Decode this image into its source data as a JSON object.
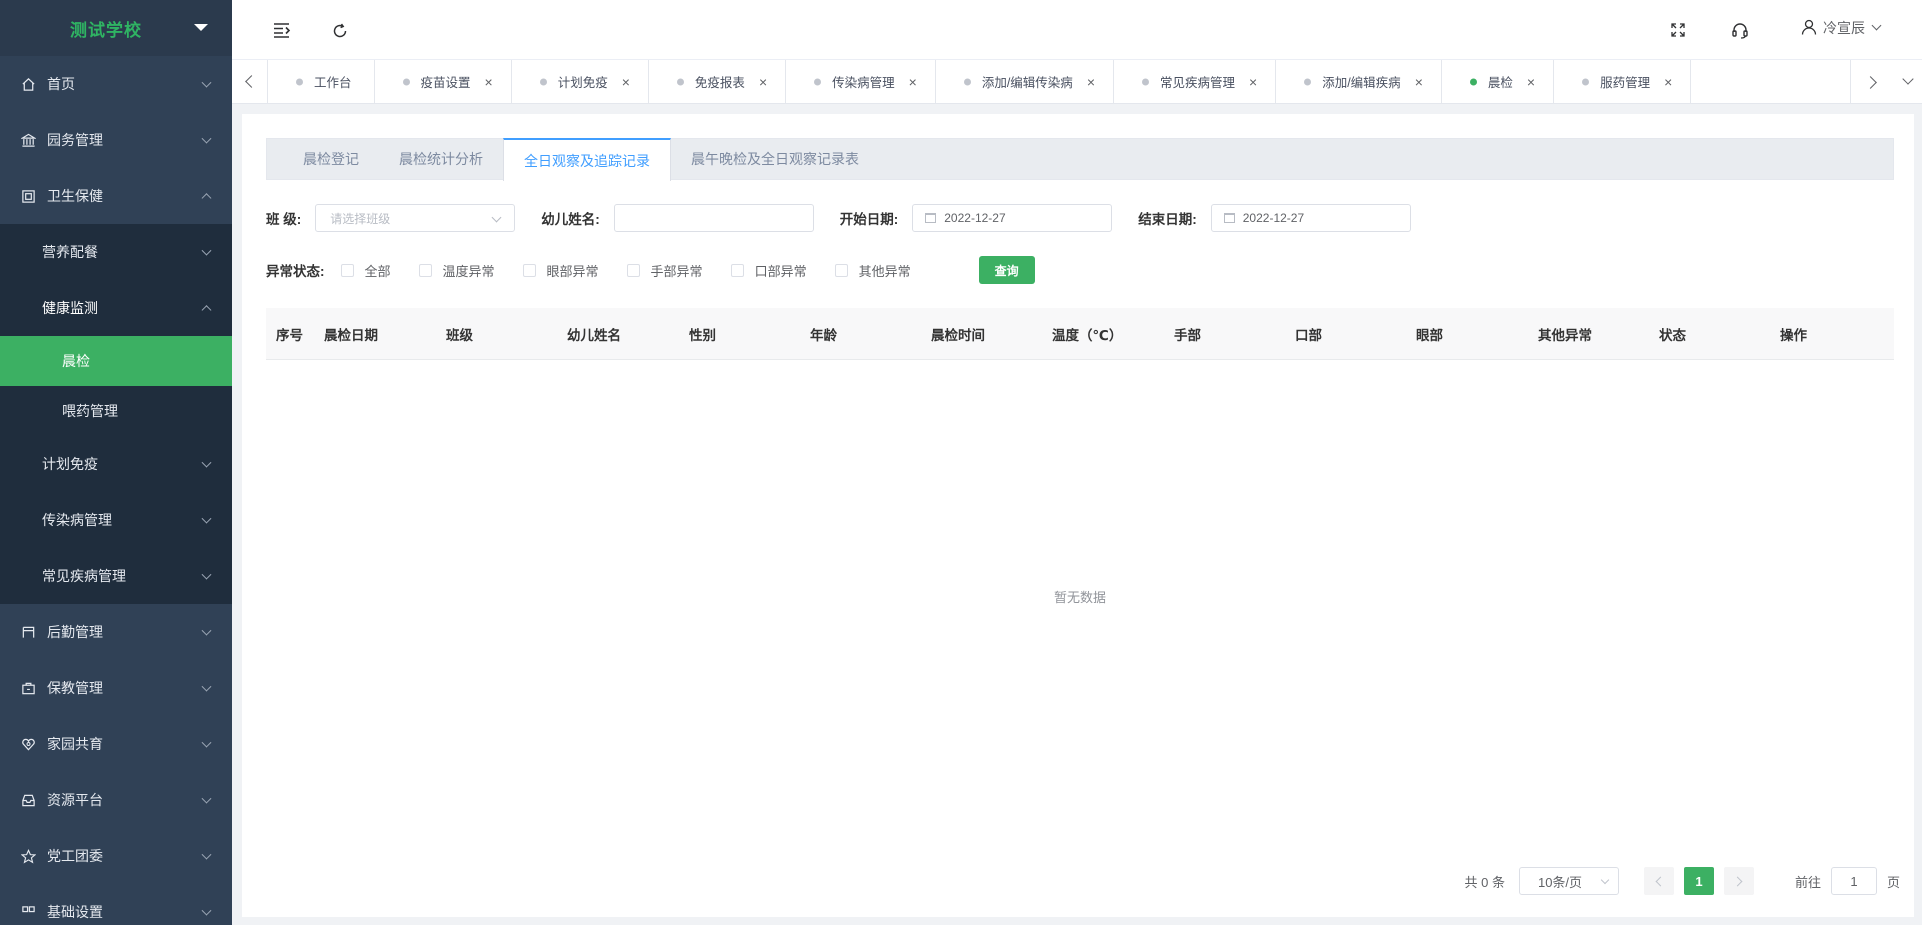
{
  "sidebar": {
    "school_name": "测试学校",
    "items": [
      {
        "label": "首页",
        "icon": "home-icon"
      },
      {
        "label": "园务管理",
        "icon": "bank-icon"
      },
      {
        "label": "卫生保健",
        "icon": "health-icon"
      }
    ],
    "health_sub": {
      "nutrition": "营养配餐",
      "monitor": "健康监测",
      "morning_check": "晨检",
      "medication": "喂药管理",
      "immunization": "计划免疫",
      "infectious": "传染病管理",
      "common_disease": "常见疾病管理"
    },
    "bottom_items": [
      {
        "label": "后勤管理",
        "icon": "logistics-icon"
      },
      {
        "label": "保教管理",
        "icon": "education-icon"
      },
      {
        "label": "家园共育",
        "icon": "heart-icon"
      },
      {
        "label": "资源平台",
        "icon": "inbox-icon"
      },
      {
        "label": "党工团委",
        "icon": "star-icon"
      },
      {
        "label": "基础设置",
        "icon": "settings-icon"
      }
    ]
  },
  "navbar": {
    "user_name": "冷宣辰"
  },
  "tags": [
    {
      "label": "工作台",
      "active": false,
      "closable": false
    },
    {
      "label": "疫苗设置",
      "active": false,
      "closable": true
    },
    {
      "label": "计划免疫",
      "active": false,
      "closable": true
    },
    {
      "label": "免疫报表",
      "active": false,
      "closable": true
    },
    {
      "label": "传染病管理",
      "active": false,
      "closable": true
    },
    {
      "label": "添加/编辑传染病",
      "active": false,
      "closable": true
    },
    {
      "label": "常见疾病管理",
      "active": false,
      "closable": true
    },
    {
      "label": "添加/编辑疾病",
      "active": false,
      "closable": true
    },
    {
      "label": "晨检",
      "active": true,
      "closable": true
    },
    {
      "label": "服药管理",
      "active": false,
      "closable": true
    }
  ],
  "tag_close_glyph": "×",
  "tabs": [
    {
      "label": "晨检登记",
      "active": false
    },
    {
      "label": "晨检统计分析",
      "active": false
    },
    {
      "label": "全日观察及追踪记录",
      "active": true
    },
    {
      "label": "晨午晚检及全日观察记录表",
      "active": false
    }
  ],
  "filters": {
    "class_label": "班 级:",
    "class_placeholder": "请选择班级",
    "child_label": "幼儿姓名:",
    "child_value": "",
    "start_label": "开始日期:",
    "start_value": "2022-12-27",
    "end_label": "结束日期:",
    "end_value": "2022-12-27",
    "status_label": "异常状态:",
    "checkboxes": [
      "全部",
      "温度异常",
      "眼部异常",
      "手部异常",
      "口部异常",
      "其他异常"
    ],
    "query_button": "查询"
  },
  "table": {
    "columns": [
      "序号",
      "晨检日期",
      "班级",
      "幼儿姓名",
      "性别",
      "年龄",
      "晨检时间",
      "温度（℃）",
      "手部",
      "口部",
      "眼部",
      "其他异常",
      "状态",
      "操作"
    ],
    "empty_text": "暂无数据"
  },
  "pagination": {
    "total_text": "共 0 条",
    "page_size": "10条/页",
    "current_page": "1",
    "goto_label": "前往",
    "goto_value": "1",
    "page_suffix": "页"
  },
  "colors": {
    "sidebar_bg": "#304156",
    "accent_green": "#3cb063",
    "link_blue": "#409eff"
  }
}
